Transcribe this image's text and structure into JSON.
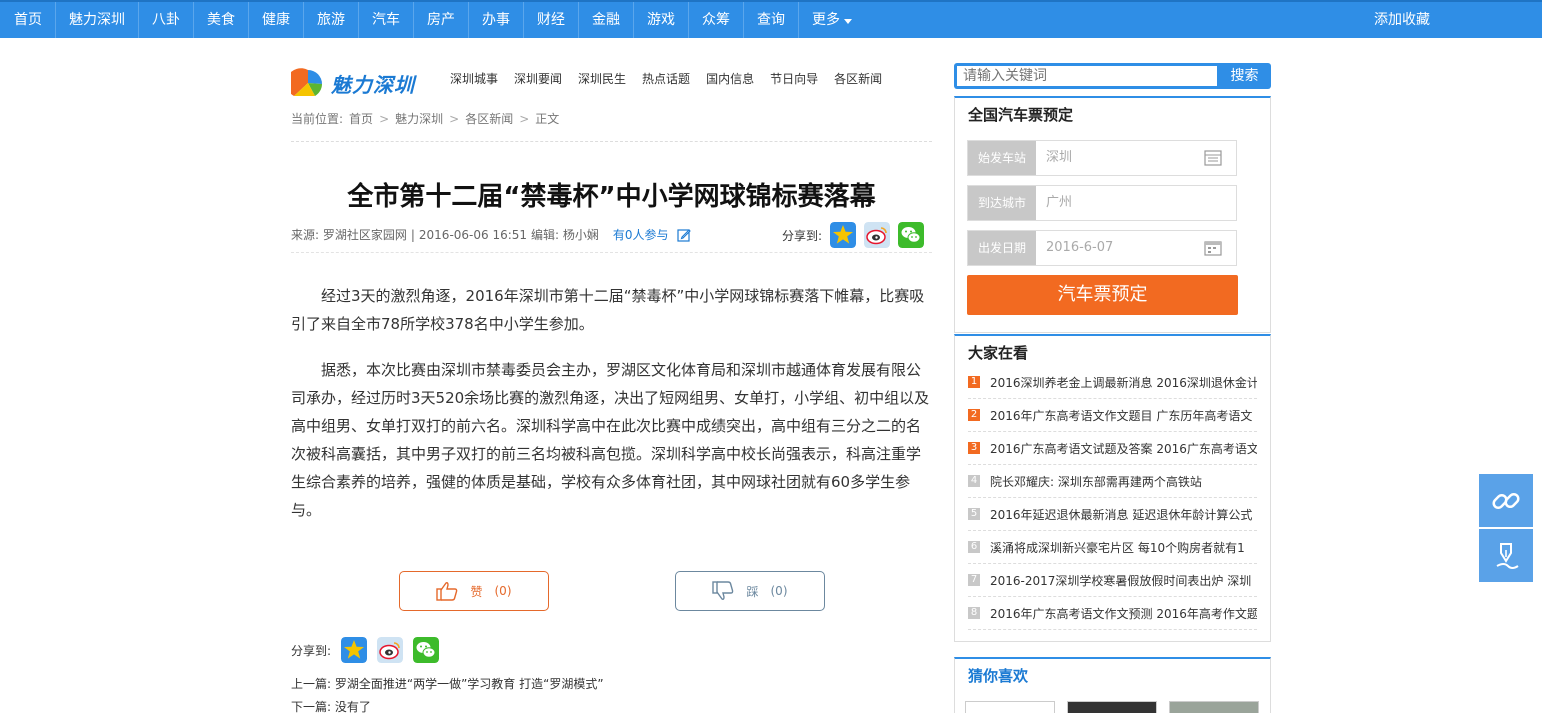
{
  "topnav": {
    "items": [
      "首页",
      "魅力深圳",
      "八卦",
      "美食",
      "健康",
      "旅游",
      "汽车",
      "房产",
      "办事",
      "财经",
      "金融",
      "游戏",
      "众筹",
      "查询"
    ],
    "more": "更多",
    "favorite": "添加收藏"
  },
  "logo": {
    "text": "魅力深圳"
  },
  "subnav": {
    "items": [
      "深圳城事",
      "深圳要闻",
      "深圳民生",
      "热点话题",
      "国内信息",
      "节日向导",
      "各区新闻"
    ]
  },
  "breadcrumb": {
    "prefix": "当前位置:",
    "items": [
      "首页",
      "魅力深圳",
      "各区新闻",
      "正文"
    ]
  },
  "article": {
    "title": "全市第十二届“禁毒杯”中小学网球锦标赛落幕",
    "source": "来源: 罗湖社区家园网",
    "date": "2016-06-06 16:51",
    "editor": "编辑: 杨小娴",
    "participants": "有0人参与",
    "share_label": "分享到:",
    "paragraphs": [
      "经过3天的激烈角逐，2016年深圳市第十二届“禁毒杯”中小学网球锦标赛落下帷幕，比赛吸引了来自全市78所学校378名中小学生参加。",
      "据悉，本次比赛由深圳市禁毒委员会主办，罗湖区文化体育局和深圳市越通体育发展有限公司承办，经过历时3天520余场比赛的激烈角逐，决出了短网组男、女单打，小学组、初中组以及高中组男、女单打双打的前六名。深圳科学高中在此次比赛中成绩突出，高中组有三分之二的名次被科高囊括，其中男子双打的前三名均被科高包揽。深圳科学高中校长尚强表示，科高注重学生综合素养的培养，强健的体质是基础，学校有众多体育社团，其中网球社团就有60多学生参与。"
    ],
    "like_label": "赞",
    "like_count": "(0)",
    "dislike_label": "踩",
    "dislike_count": "(0)",
    "prev_label": "上一篇:",
    "prev_title": "罗湖全面推进“两学一做”学习教育 打造“罗湖模式”",
    "next_label": "下一篇:",
    "next_title": "没有了"
  },
  "search": {
    "placeholder": "请输入关键词",
    "button": "搜索"
  },
  "bus": {
    "title": "全国汽车票预定",
    "from_label": "始发车站",
    "from_value": "深圳",
    "to_label": "到达城市",
    "to_value": "广州",
    "date_label": "出发日期",
    "date_value": "2016-6-07",
    "button": "汽车票预定"
  },
  "hot": {
    "title": "大家在看",
    "items": [
      {
        "rank": "1",
        "text": "2016深圳养老金上调最新消息 2016深圳退休金计"
      },
      {
        "rank": "2",
        "text": "2016年广东高考语文作文题目 广东历年高考语文"
      },
      {
        "rank": "3",
        "text": "2016广东高考语文试题及答案 2016广东高考语文"
      },
      {
        "rank": "4",
        "text": "院长邓耀庆: 深圳东部需再建两个高铁站"
      },
      {
        "rank": "5",
        "text": "2016年延迟退休最新消息 延迟退休年龄计算公式"
      },
      {
        "rank": "6",
        "text": "溪涌将成深圳新兴豪宅片区 每10个购房者就有1"
      },
      {
        "rank": "7",
        "text": "2016-2017深圳学校寒暑假放假时间表出炉 深圳"
      },
      {
        "rank": "8",
        "text": "2016年广东高考语文作文预测 2016年高考作文题"
      }
    ]
  },
  "guess": {
    "title": "猜你喜欢"
  },
  "colors": {
    "brand": "#2f8ee6",
    "accent": "#f26a21"
  }
}
